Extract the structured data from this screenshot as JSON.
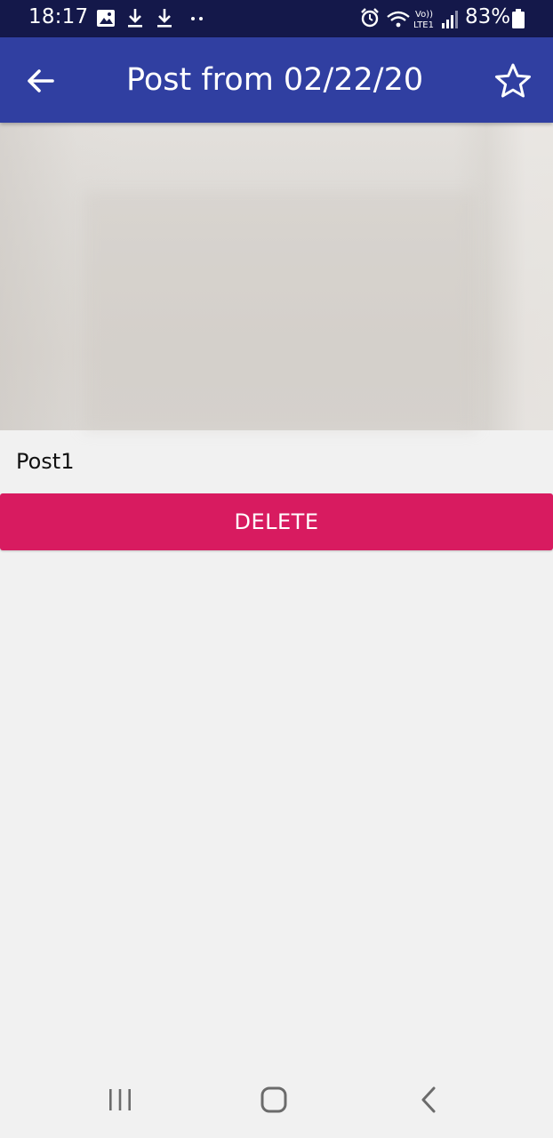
{
  "status_bar": {
    "time": "18:17",
    "battery_percent": "83%",
    "left_icons": [
      "gallery-icon",
      "download-icon",
      "download-icon",
      "more-dots-icon"
    ],
    "right_icons": [
      "alarm-icon",
      "wifi-icon",
      "volte-icon",
      "signal-icon",
      "battery-icon"
    ],
    "volte_line1": "Vo))",
    "volte_line2": "LTE1"
  },
  "app_bar": {
    "title": "Post from 02/22/20",
    "back_icon": "arrow-back-icon",
    "favorite_icon": "star-outline-icon",
    "background_color": "#303fa1"
  },
  "post": {
    "title": "Post1",
    "image_alt": "post-photo"
  },
  "actions": {
    "delete_label": "DELETE",
    "delete_color": "#d81b60"
  },
  "nav_bar": {
    "recents_icon": "recents-icon",
    "home_icon": "home-icon",
    "back_icon": "back-icon"
  }
}
